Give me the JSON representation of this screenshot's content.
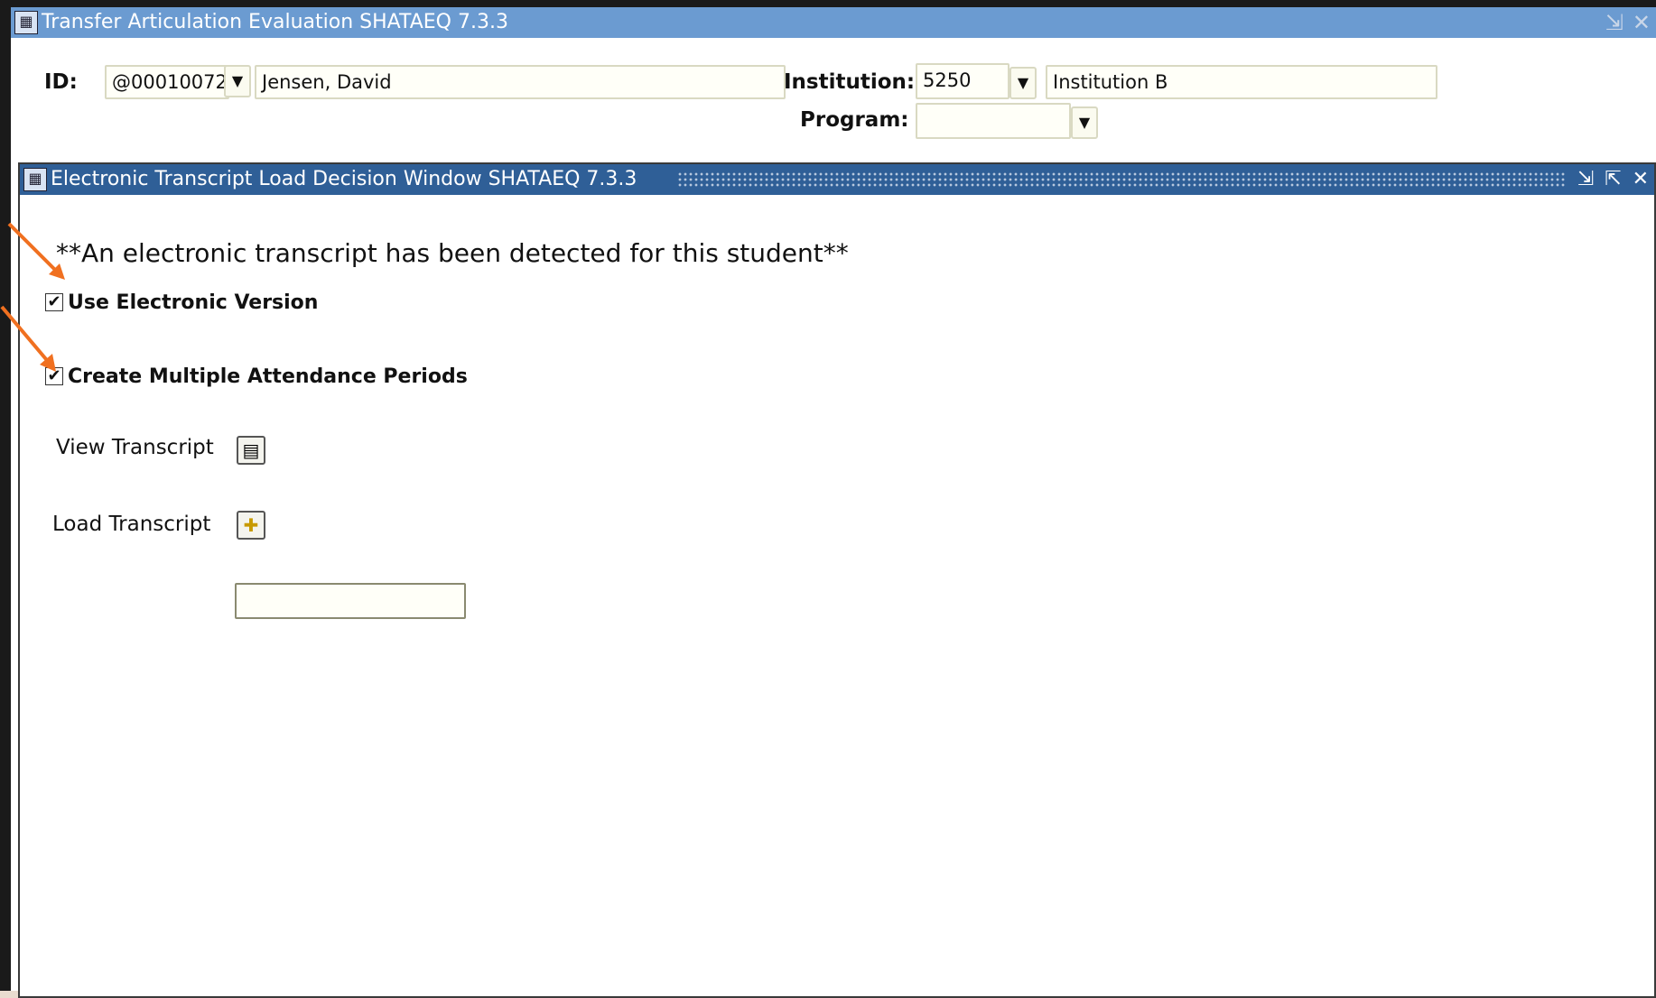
{
  "main_window": {
    "title": "Transfer Articulation Evaluation  SHATAEQ  7.3.3",
    "icon": "app-icon",
    "controls": [
      "minimize-icon",
      "close-icon"
    ]
  },
  "key_block": {
    "id_label": "ID:",
    "id_value": "@00010072",
    "name_value": "Jensen, David",
    "institution_label": "Institution:",
    "institution_code": "5250",
    "institution_name": "Institution B",
    "program_label": "Program:",
    "program_value": ""
  },
  "dialog": {
    "title": "Electronic Transcript Load Decision Window  SHATAEQ  7.3.3",
    "notice": "**An electronic transcript has been detected for this student**",
    "use_electronic_label": "Use Electronic Version",
    "use_electronic_checked": true,
    "multiple_periods_label": "Create Multiple Attendance Periods",
    "multiple_periods_checked": true,
    "view_transcript_label": "View Transcript",
    "load_transcript_label": "Load Transcript",
    "text_field_value": ""
  },
  "glyphs": {
    "dropdown": "▼",
    "check": "✔",
    "minimize": "⇲",
    "close": "✕",
    "maximize": "⇱",
    "view": "▤",
    "load": "✚"
  },
  "colors": {
    "main_titlebar": "#6b9bd1",
    "dialog_titlebar": "#2f5f97",
    "annotation_arrow": "#f07020"
  }
}
